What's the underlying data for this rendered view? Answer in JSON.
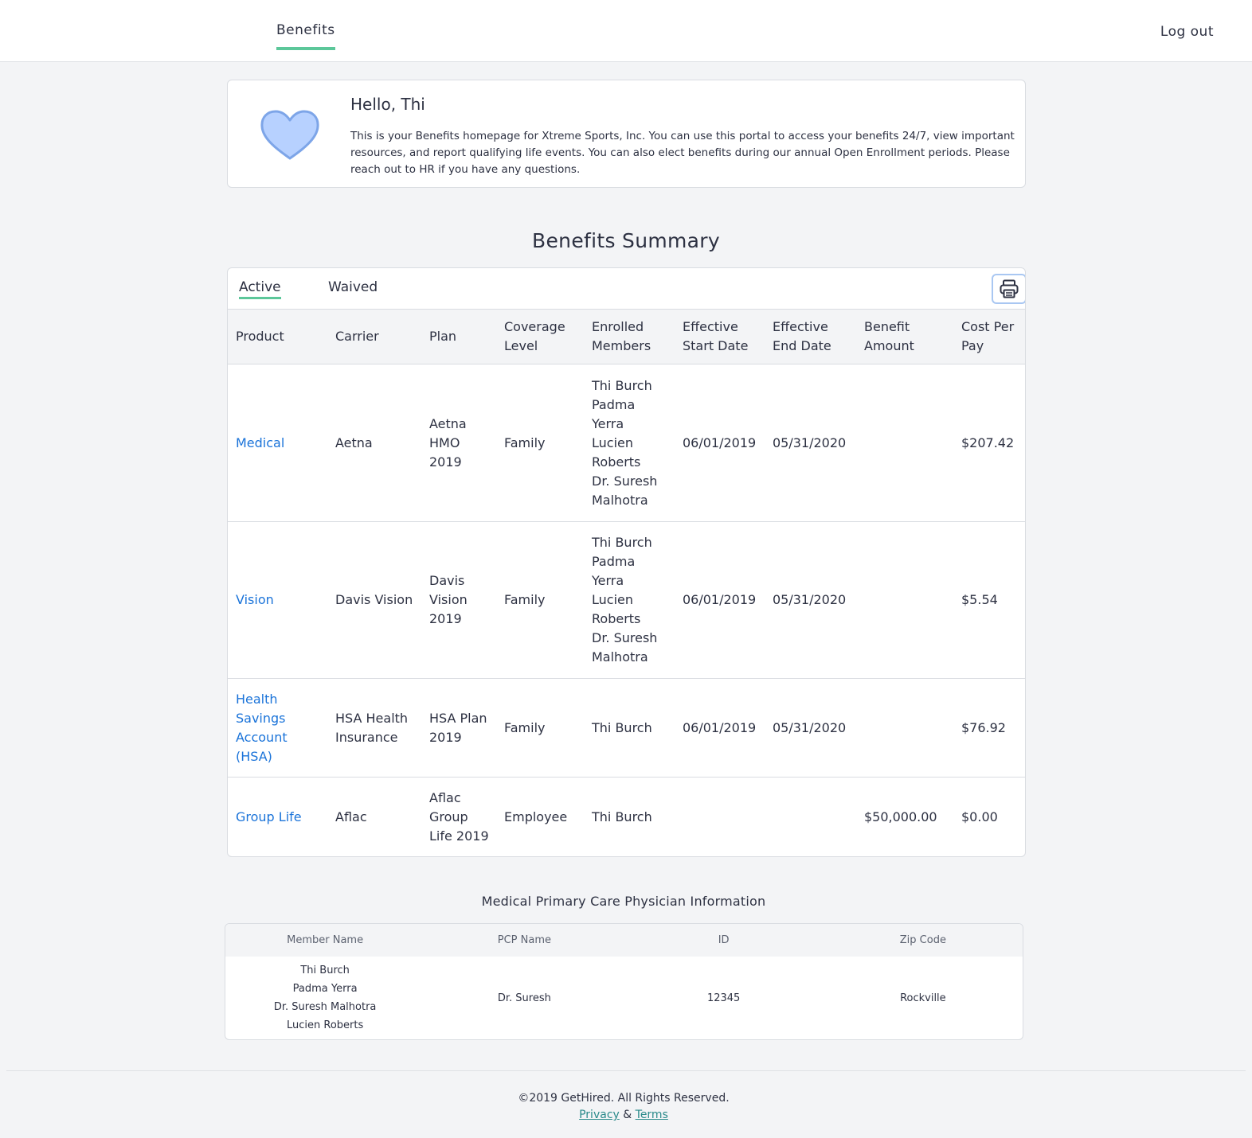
{
  "header": {
    "nav_tab": "Benefits",
    "logout_label": "Log out"
  },
  "welcome": {
    "icon": "heart-icon",
    "greeting": "Hello, Thi",
    "intro": "This is your Benefits homepage for Xtreme Sports, Inc. You can use this portal to access your benefits 24/7, view important resources, and report qualifying life events. You can also elect benefits during our annual Open Enrollment periods. Please reach out to HR if you have any questions."
  },
  "summary": {
    "title": "Benefits Summary",
    "tabs": {
      "active": "Active",
      "waived": "Waived"
    },
    "print_icon": "printer-icon",
    "columns": [
      "Product",
      "Carrier",
      "Plan",
      "Coverage Level",
      "Enrolled Members",
      "Effective Start Date",
      "Effective End Date",
      "Benefit Amount",
      "Cost Per Pay"
    ],
    "rows": [
      {
        "product": "Medical",
        "carrier": "Aetna",
        "plan": "Aetna HMO 2019",
        "coverage": "Family",
        "members": [
          "Thi Burch",
          "Padma Yerra",
          "Lucien Roberts",
          "Dr. Suresh Malhotra"
        ],
        "start": "06/01/2019",
        "end": "05/31/2020",
        "amount": "",
        "cost": "$207.42"
      },
      {
        "product": "Vision",
        "carrier": "Davis Vision",
        "plan": "Davis Vision 2019",
        "coverage": "Family",
        "members": [
          "Thi Burch",
          "Padma Yerra",
          "Lucien Roberts",
          "Dr. Suresh Malhotra"
        ],
        "start": "06/01/2019",
        "end": "05/31/2020",
        "amount": "",
        "cost": "$5.54"
      },
      {
        "product": "Health Savings Account (HSA)",
        "carrier": "HSA Health Insurance",
        "plan": "HSA Plan 2019",
        "coverage": "Family",
        "members": [
          "Thi Burch"
        ],
        "start": "06/01/2019",
        "end": "05/31/2020",
        "amount": "",
        "cost": "$76.92"
      },
      {
        "product": "Group Life",
        "carrier": "Aflac",
        "plan": "Aflac Group Life 2019",
        "coverage": "Employee",
        "members": [
          "Thi Burch"
        ],
        "start": "",
        "end": "",
        "amount": "$50,000.00",
        "cost": "$0.00"
      }
    ]
  },
  "pcp": {
    "title": "Medical Primary Care Physician Information",
    "columns": [
      "Member Name",
      "PCP Name",
      "ID",
      "Zip Code"
    ],
    "row": {
      "members": [
        "Thi Burch",
        "Padma Yerra",
        "Dr. Suresh Malhotra",
        "Lucien Roberts"
      ],
      "pcp_name": "Dr. Suresh",
      "id": "12345",
      "zip": "Rockville"
    }
  },
  "footer": {
    "copyright": "©2019 GetHired. All Rights Reserved.",
    "privacy": "Privacy",
    "amp": "&",
    "terms": "Terms"
  },
  "colors": {
    "accent_green": "#5cc79a",
    "link_blue": "#1a73d9",
    "heart_fill": "#b7d1ff",
    "heart_stroke": "#7da5e8"
  }
}
